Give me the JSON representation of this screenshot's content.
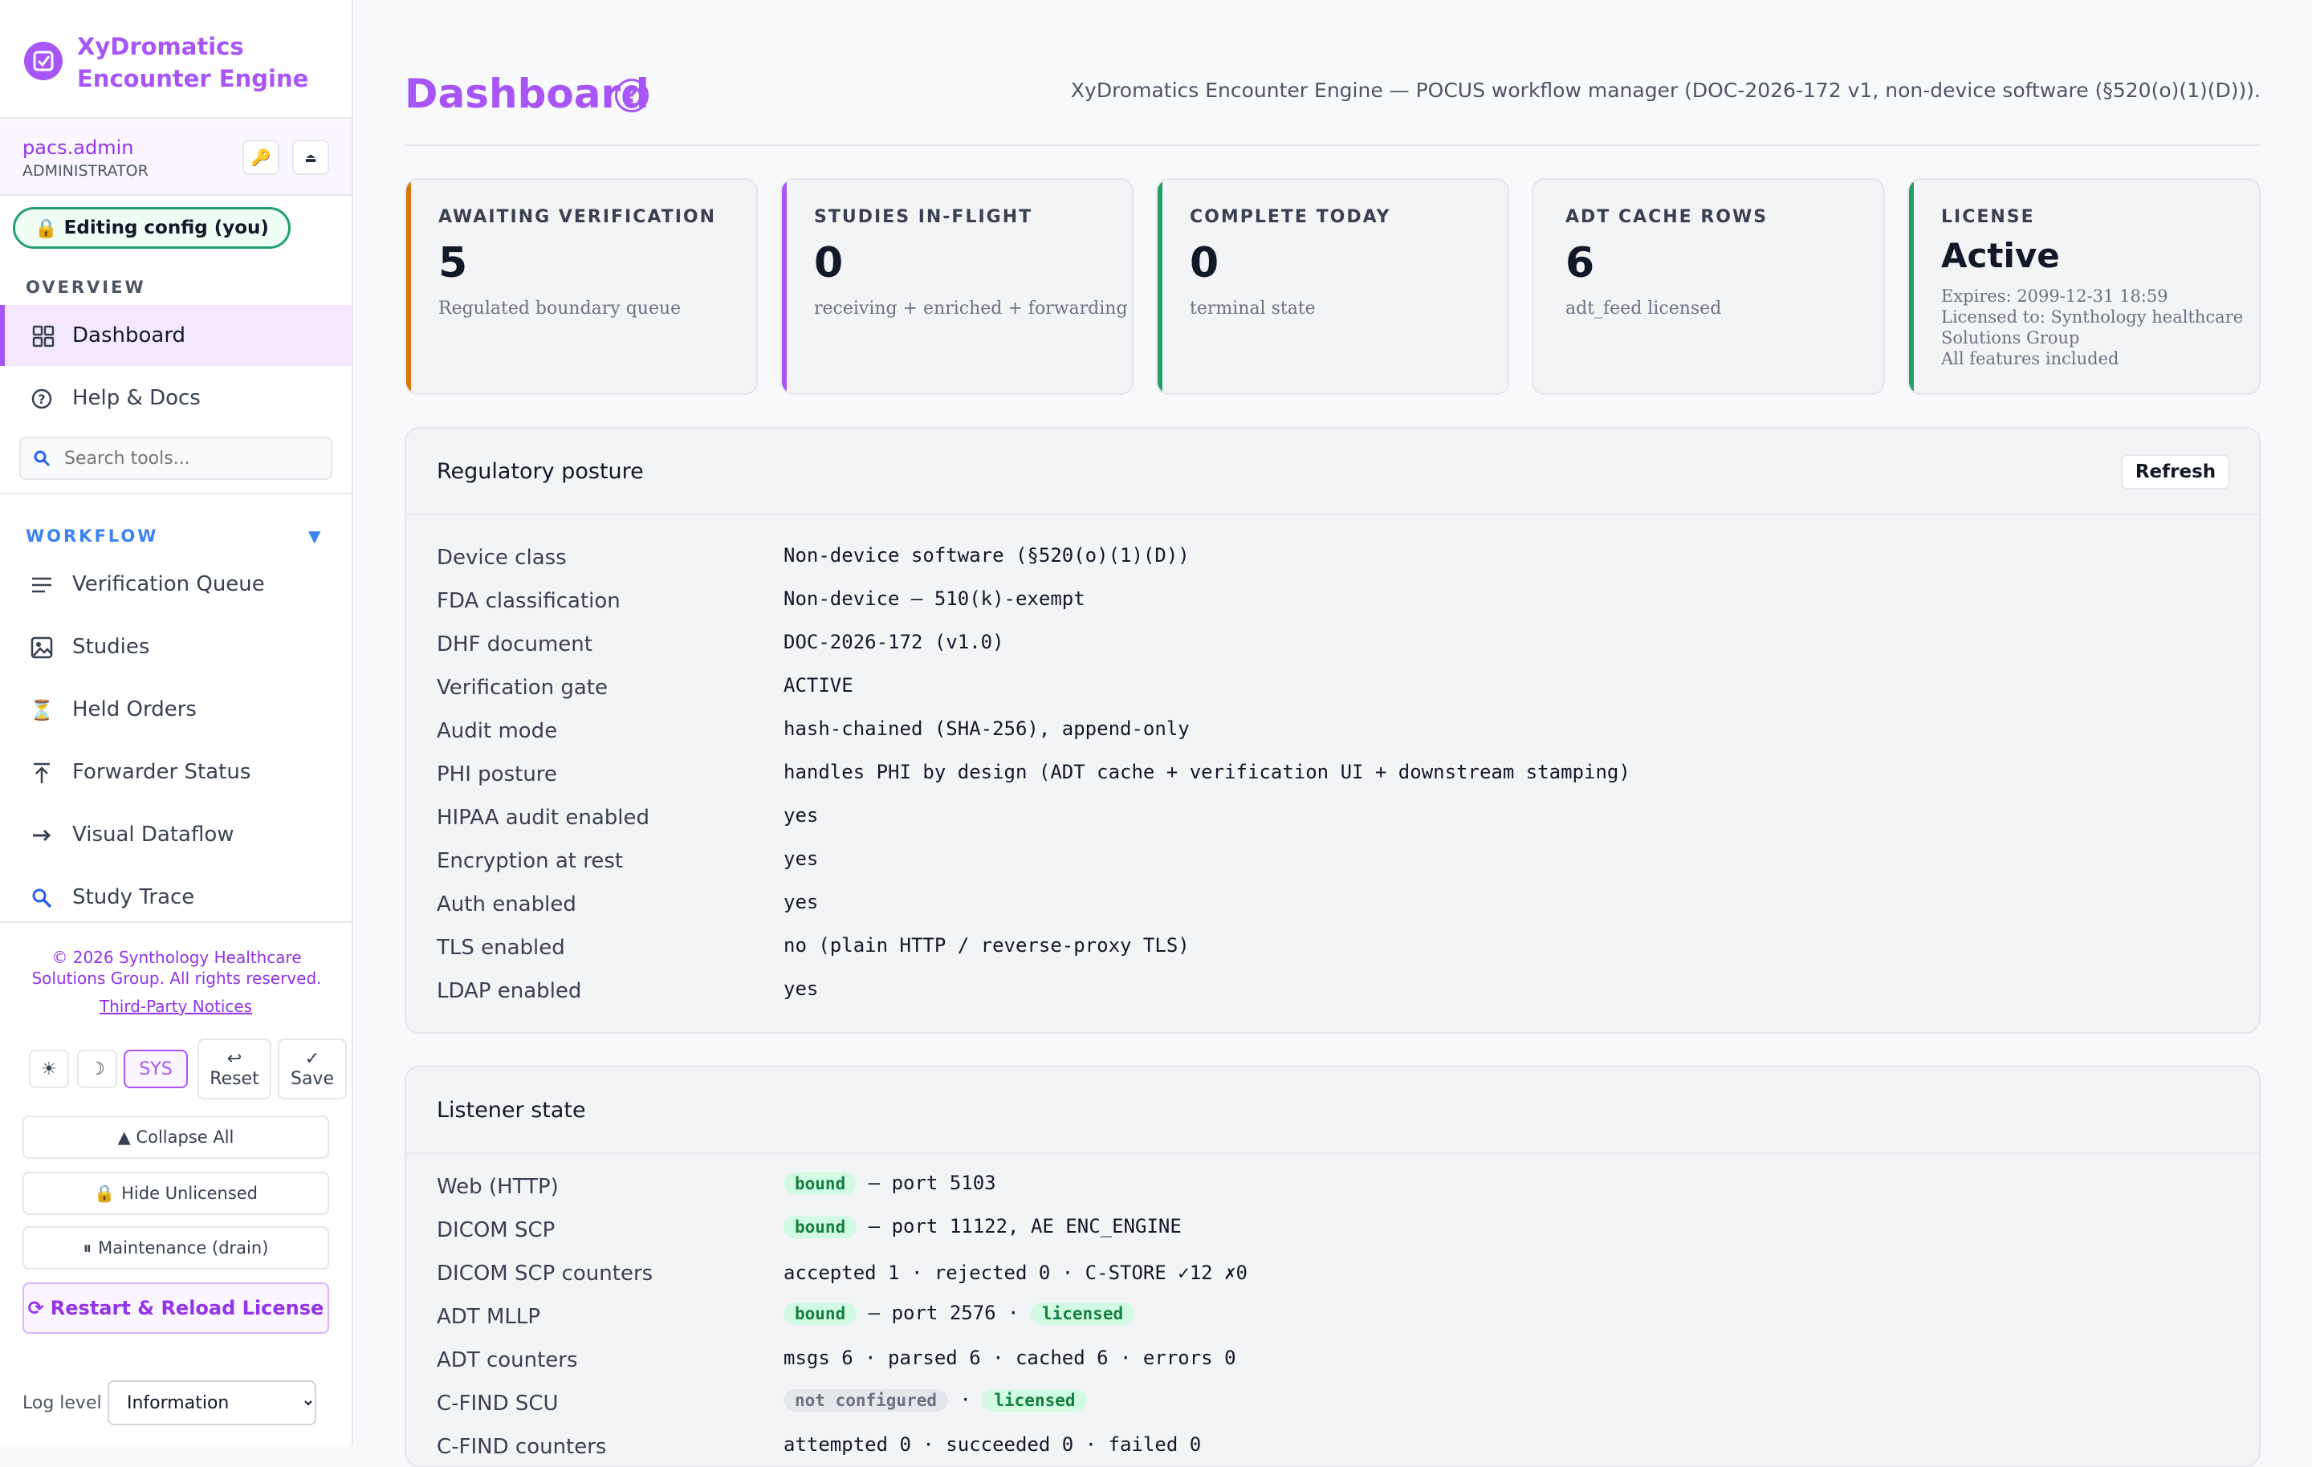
{
  "app": {
    "name_line1": "XyDromatics",
    "name_line2": "Encounter Engine"
  },
  "user": {
    "name": "pacs.admin",
    "role": "ADMINISTRATOR"
  },
  "editing_badge": "Editing config (you)",
  "sections": {
    "overview": "OVERVIEW",
    "workflow": "WORKFLOW"
  },
  "nav_overview": [
    {
      "label": "Dashboard",
      "icon": "grid-icon",
      "active": true
    },
    {
      "label": "Help & Docs",
      "icon": "question-circle-icon",
      "active": false
    }
  ],
  "search": {
    "placeholder": "Search tools..."
  },
  "nav_workflow": [
    {
      "label": "Verification Queue",
      "icon": "list-icon"
    },
    {
      "label": "Studies",
      "icon": "image-icon"
    },
    {
      "label": "Held Orders",
      "icon": "hourglass-icon"
    },
    {
      "label": "Forwarder Status",
      "icon": "upload-arrow-icon"
    },
    {
      "label": "Visual Dataflow",
      "icon": "arrow-right-icon"
    },
    {
      "label": "Study Trace",
      "icon": "magnifier-icon"
    }
  ],
  "footer": {
    "copyright_line1": "© 2026 Synthology Healthcare",
    "copyright_line2": "Solutions Group. All rights reserved.",
    "third_party": "Third-Party Notices",
    "theme_sys": "SYS",
    "reset": "Reset",
    "save": "Save",
    "collapse_all": "▲ Collapse All",
    "hide_unlicensed": "Hide Unlicensed",
    "maintenance": "Maintenance (drain)",
    "restart": "Restart & Reload License",
    "log_level_label": "Log level",
    "log_level_value": "Information"
  },
  "header": {
    "title": "Dashboard",
    "subtitle": "XyDromatics Encounter Engine — POCUS workflow manager (DOC-2026-172 v1, non-device software (§520(o)(1)(D)))."
  },
  "cards": [
    {
      "key": "AWAITING VERIFICATION",
      "value": "5",
      "sub": "Regulated boundary queue",
      "accent": "#d97706"
    },
    {
      "key": "STUDIES IN-FLIGHT",
      "value": "0",
      "sub": "receiving + enriched + forwarding",
      "accent": "#a855f7"
    },
    {
      "key": "COMPLETE TODAY",
      "value": "0",
      "sub": "terminal state",
      "accent": "#22a06b"
    },
    {
      "key": "ADT CACHE ROWS",
      "value": "6",
      "sub": "adt_feed licensed",
      "accent": "#e5e7eb"
    }
  ],
  "license": {
    "key": "LICENSE",
    "status": "Active",
    "expires": "Expires: 2099-12-31 18:59",
    "licensed_to_1": "Licensed to: Synthology healthcare",
    "licensed_to_2": "Solutions Group",
    "features": "All features included",
    "accent": "#22a06b"
  },
  "regulatory": {
    "title": "Regulatory posture",
    "refresh": "Refresh",
    "rows": [
      {
        "k": "Device class",
        "v": "Non-device software (§520(o)(1)(D))"
      },
      {
        "k": "FDA classification",
        "v": "Non-device — 510(k)-exempt"
      },
      {
        "k": "DHF document",
        "v": "DOC-2026-172 (v1.0)"
      },
      {
        "k": "Verification gate",
        "v": "ACTIVE"
      },
      {
        "k": "Audit mode",
        "v": "hash-chained (SHA-256), append-only"
      },
      {
        "k": "PHI posture",
        "v": "handles PHI by design (ADT cache + verification UI + downstream stamping)"
      },
      {
        "k": "HIPAA audit enabled",
        "v": "yes"
      },
      {
        "k": "Encryption at rest",
        "v": "yes"
      },
      {
        "k": "Auth enabled",
        "v": "yes"
      },
      {
        "k": "TLS enabled",
        "v": "no (plain HTTP / reverse-proxy TLS)"
      },
      {
        "k": "LDAP enabled",
        "v": "yes"
      }
    ]
  },
  "listener": {
    "title": "Listener state",
    "web": {
      "k": "Web (HTTP)",
      "badge": "bound",
      "rest": " — port 5103"
    },
    "dicom_scp": {
      "k": "DICOM SCP",
      "badge": "bound",
      "rest": " — port 11122, AE ENC_ENGINE"
    },
    "dicom_counters": {
      "k": "DICOM SCP counters",
      "v": "accepted 1 · rejected 0 · C-STORE ✓12 ✗0"
    },
    "adt_mllp": {
      "k": "ADT MLLP",
      "badge": "bound",
      "rest": " — port 2576 · ",
      "badge2": "licensed"
    },
    "adt_counters": {
      "k": "ADT counters",
      "v": "msgs 6 · parsed 6 · cached 6 · errors 0"
    },
    "cfind_scu": {
      "k": "C-FIND SCU",
      "badge": "not configured",
      "rest": " · ",
      "badge2": "licensed"
    },
    "cfind_counters": {
      "k": "C-FIND counters",
      "v": "attempted 0 · succeeded 0 · failed 0"
    }
  }
}
